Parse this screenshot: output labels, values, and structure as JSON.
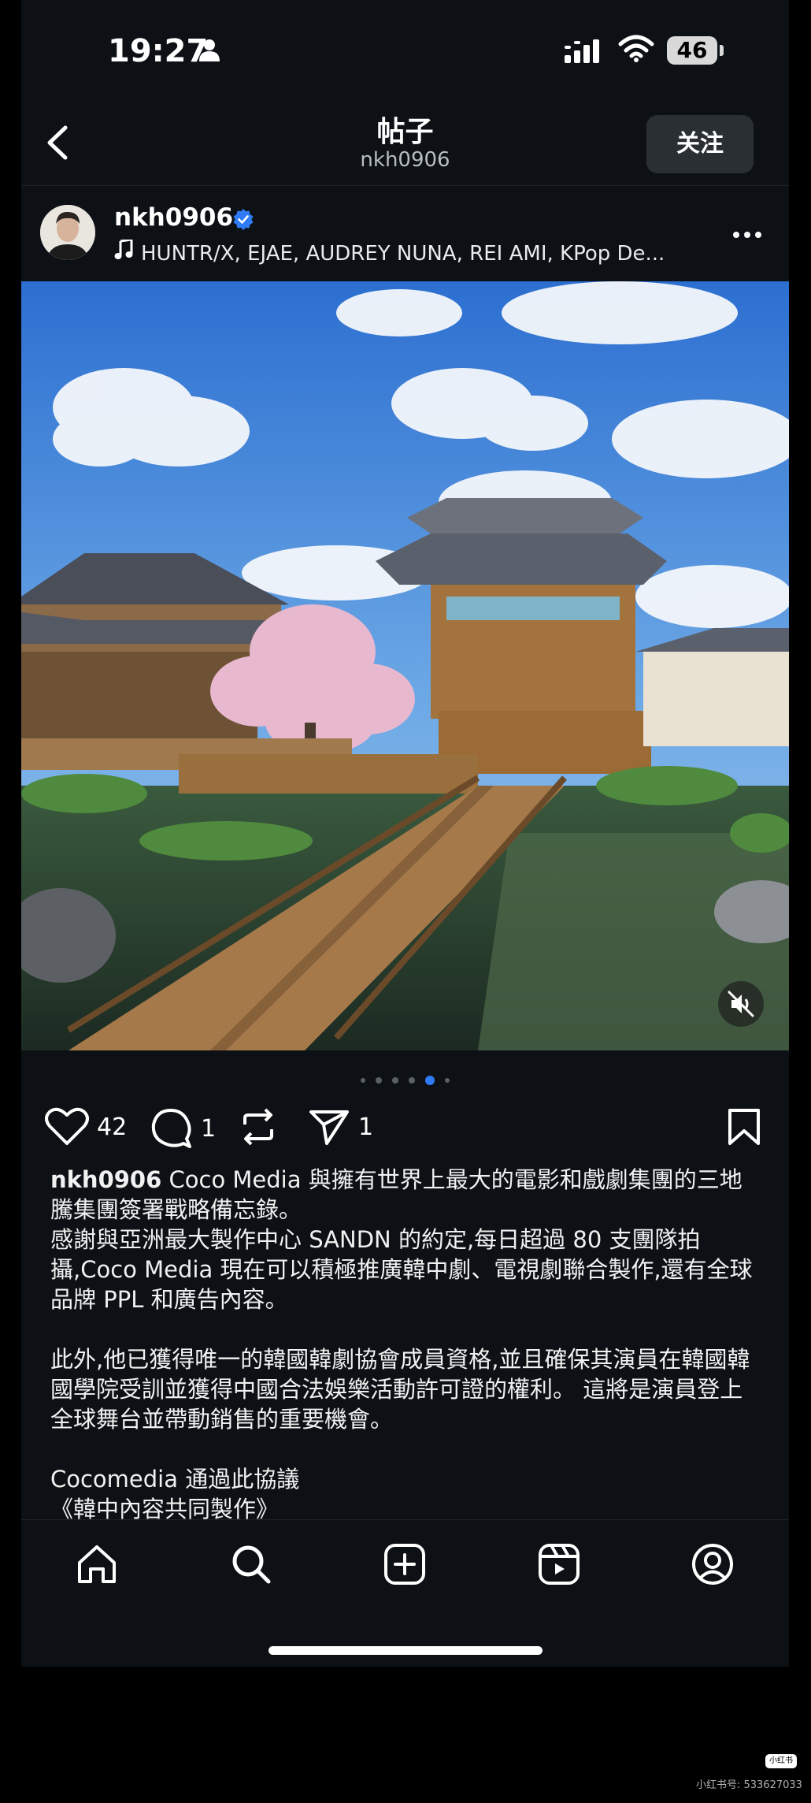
{
  "status_bar": {
    "time": "19:27",
    "battery": "46"
  },
  "header": {
    "title": "帖子",
    "subtitle": "nkh0906",
    "follow_label": "关注"
  },
  "post": {
    "username": "nkh0906",
    "music": "HUNTR/X, EJAE, AUDREY NUNA, REI AMI, KPop De...",
    "likes": "42",
    "comments": "1",
    "shares": "1",
    "carousel": {
      "count": 6,
      "active_index": 4
    }
  },
  "caption": {
    "username": "nkh0906",
    "lines": [
      "Coco Media 與擁有世界上最大的電影和戲劇集團的三地騰集團簽署戰略備忘錄。",
      "感謝與亞洲最大製作中心 SANDN 的約定,每日超過 80 支團隊拍攝,Coco Media 現在可以積極推廣韓中劇、電視劇聯合製作,還有全球品牌 PPL 和廣告內容。",
      "此外,他已獲得唯一的韓國韓劇協會成員資格,並且確保其演員在韓國韓國學院受訓並獲得中國合法娛樂活動許可證的權利。 這將是演員登上全球舞台並帶動銷售的重要機會。",
      "Cocomedia 通過此協議",
      "《韓中內容共同製作》"
    ]
  },
  "watermark": {
    "logo": "小红书",
    "text": "小红书号: 533627033"
  },
  "colors": {
    "background": "#0d1115",
    "accent": "#2f7bf6",
    "verified": "#2f7bf6"
  }
}
